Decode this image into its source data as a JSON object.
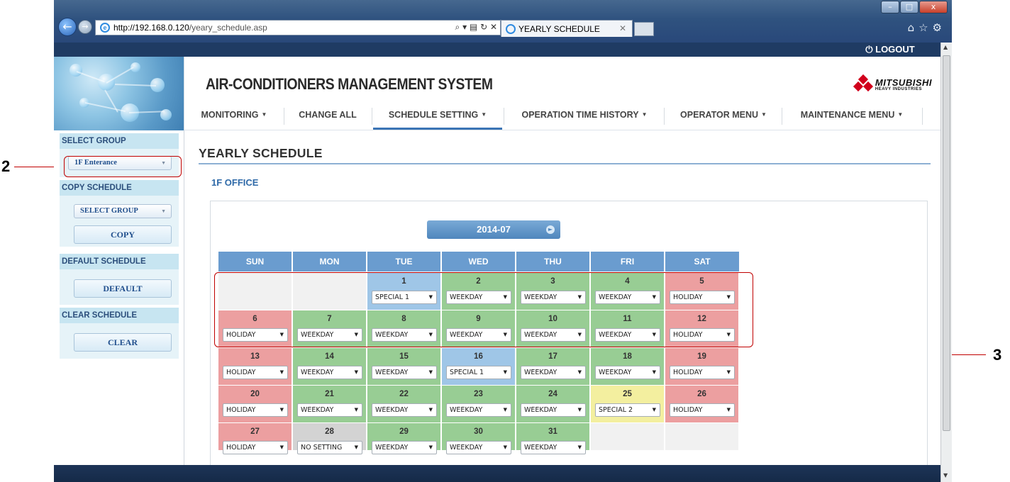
{
  "callouts": {
    "two": "2",
    "three": "3"
  },
  "browser": {
    "url_host": "http://192.168.0.120",
    "url_path": "/yeary_schedule.asp",
    "tab_title": "YEARLY SCHEDULE",
    "window_buttons": {
      "minimize": "–",
      "maximize": "□",
      "close": "x"
    }
  },
  "header": {
    "logout": "⏻ LOGOUT",
    "system_title": "AIR-CONDITIONERS MANAGEMENT SYSTEM",
    "brand_line1": "MITSUBISHI",
    "brand_line2": "HEAVY INDUSTRIES"
  },
  "menu": {
    "monitoring": "MONITORING",
    "change_all": "CHANGE ALL",
    "schedule_setting": "SCHEDULE SETTING",
    "operation_time_history": "OPERATION TIME HISTORY",
    "operator_menu": "OPERATOR MENU",
    "maintenance_menu": "MAINTENANCE MENU"
  },
  "sidebar": {
    "select_group_head": "SELECT GROUP",
    "select_group_value": "1F Enterance",
    "copy_schedule_head": "COPY SCHEDULE",
    "copy_select_value": "SELECT GROUP",
    "copy_button": "COPY",
    "default_schedule_head": "DEFAULT SCHEDULE",
    "default_button": "DEFAULT",
    "clear_schedule_head": "CLEAR SCHEDULE",
    "clear_button": "CLEAR"
  },
  "main": {
    "title": "YEARLY SCHEDULE",
    "group_name": "1F OFFICE",
    "month": "2014-07"
  },
  "calendar": {
    "weekdays": [
      "SUN",
      "MON",
      "TUE",
      "WED",
      "THU",
      "FRI",
      "SAT"
    ],
    "days": [
      {
        "day": "1",
        "setting": "SPECIAL 1"
      },
      {
        "day": "2",
        "setting": "WEEKDAY"
      },
      {
        "day": "3",
        "setting": "WEEKDAY"
      },
      {
        "day": "4",
        "setting": "WEEKDAY"
      },
      {
        "day": "5",
        "setting": "HOLIDAY"
      },
      {
        "day": "6",
        "setting": "HOLIDAY"
      },
      {
        "day": "7",
        "setting": "WEEKDAY"
      },
      {
        "day": "8",
        "setting": "WEEKDAY"
      },
      {
        "day": "9",
        "setting": "WEEKDAY"
      },
      {
        "day": "10",
        "setting": "WEEKDAY"
      },
      {
        "day": "11",
        "setting": "WEEKDAY"
      },
      {
        "day": "12",
        "setting": "HOLIDAY"
      },
      {
        "day": "13",
        "setting": "HOLIDAY"
      },
      {
        "day": "14",
        "setting": "WEEKDAY"
      },
      {
        "day": "15",
        "setting": "WEEKDAY"
      },
      {
        "day": "16",
        "setting": "SPECIAL 1"
      },
      {
        "day": "17",
        "setting": "WEEKDAY"
      },
      {
        "day": "18",
        "setting": "WEEKDAY"
      },
      {
        "day": "19",
        "setting": "HOLIDAY"
      },
      {
        "day": "20",
        "setting": "HOLIDAY"
      },
      {
        "day": "21",
        "setting": "WEEKDAY"
      },
      {
        "day": "22",
        "setting": "WEEKDAY"
      },
      {
        "day": "23",
        "setting": "WEEKDAY"
      },
      {
        "day": "24",
        "setting": "WEEKDAY"
      },
      {
        "day": "25",
        "setting": "SPECIAL 2"
      },
      {
        "day": "26",
        "setting": "HOLIDAY"
      },
      {
        "day": "27",
        "setting": "HOLIDAY"
      },
      {
        "day": "28",
        "setting": "NO SETTING"
      },
      {
        "day": "29",
        "setting": "WEEKDAY"
      },
      {
        "day": "30",
        "setting": "WEEKDAY"
      },
      {
        "day": "31",
        "setting": "WEEKDAY"
      }
    ]
  },
  "colors": {
    "weekday": "#98cd94",
    "holiday": "#ec9fa0",
    "special1": "#9fc6e7",
    "special2": "#f3ef9f",
    "no_setting": "#d3d3d3",
    "header_blue": "#6a9ccf",
    "annotation_red": "#c00000"
  },
  "icons": {
    "back": "back-arrow-icon",
    "forward": "forward-arrow-icon",
    "ie": "ie-logo-icon",
    "home": "home-icon",
    "favorites": "star-icon",
    "tools": "gear-icon",
    "dropdown": "chevron-down-icon",
    "next": "next-arrow-icon"
  }
}
